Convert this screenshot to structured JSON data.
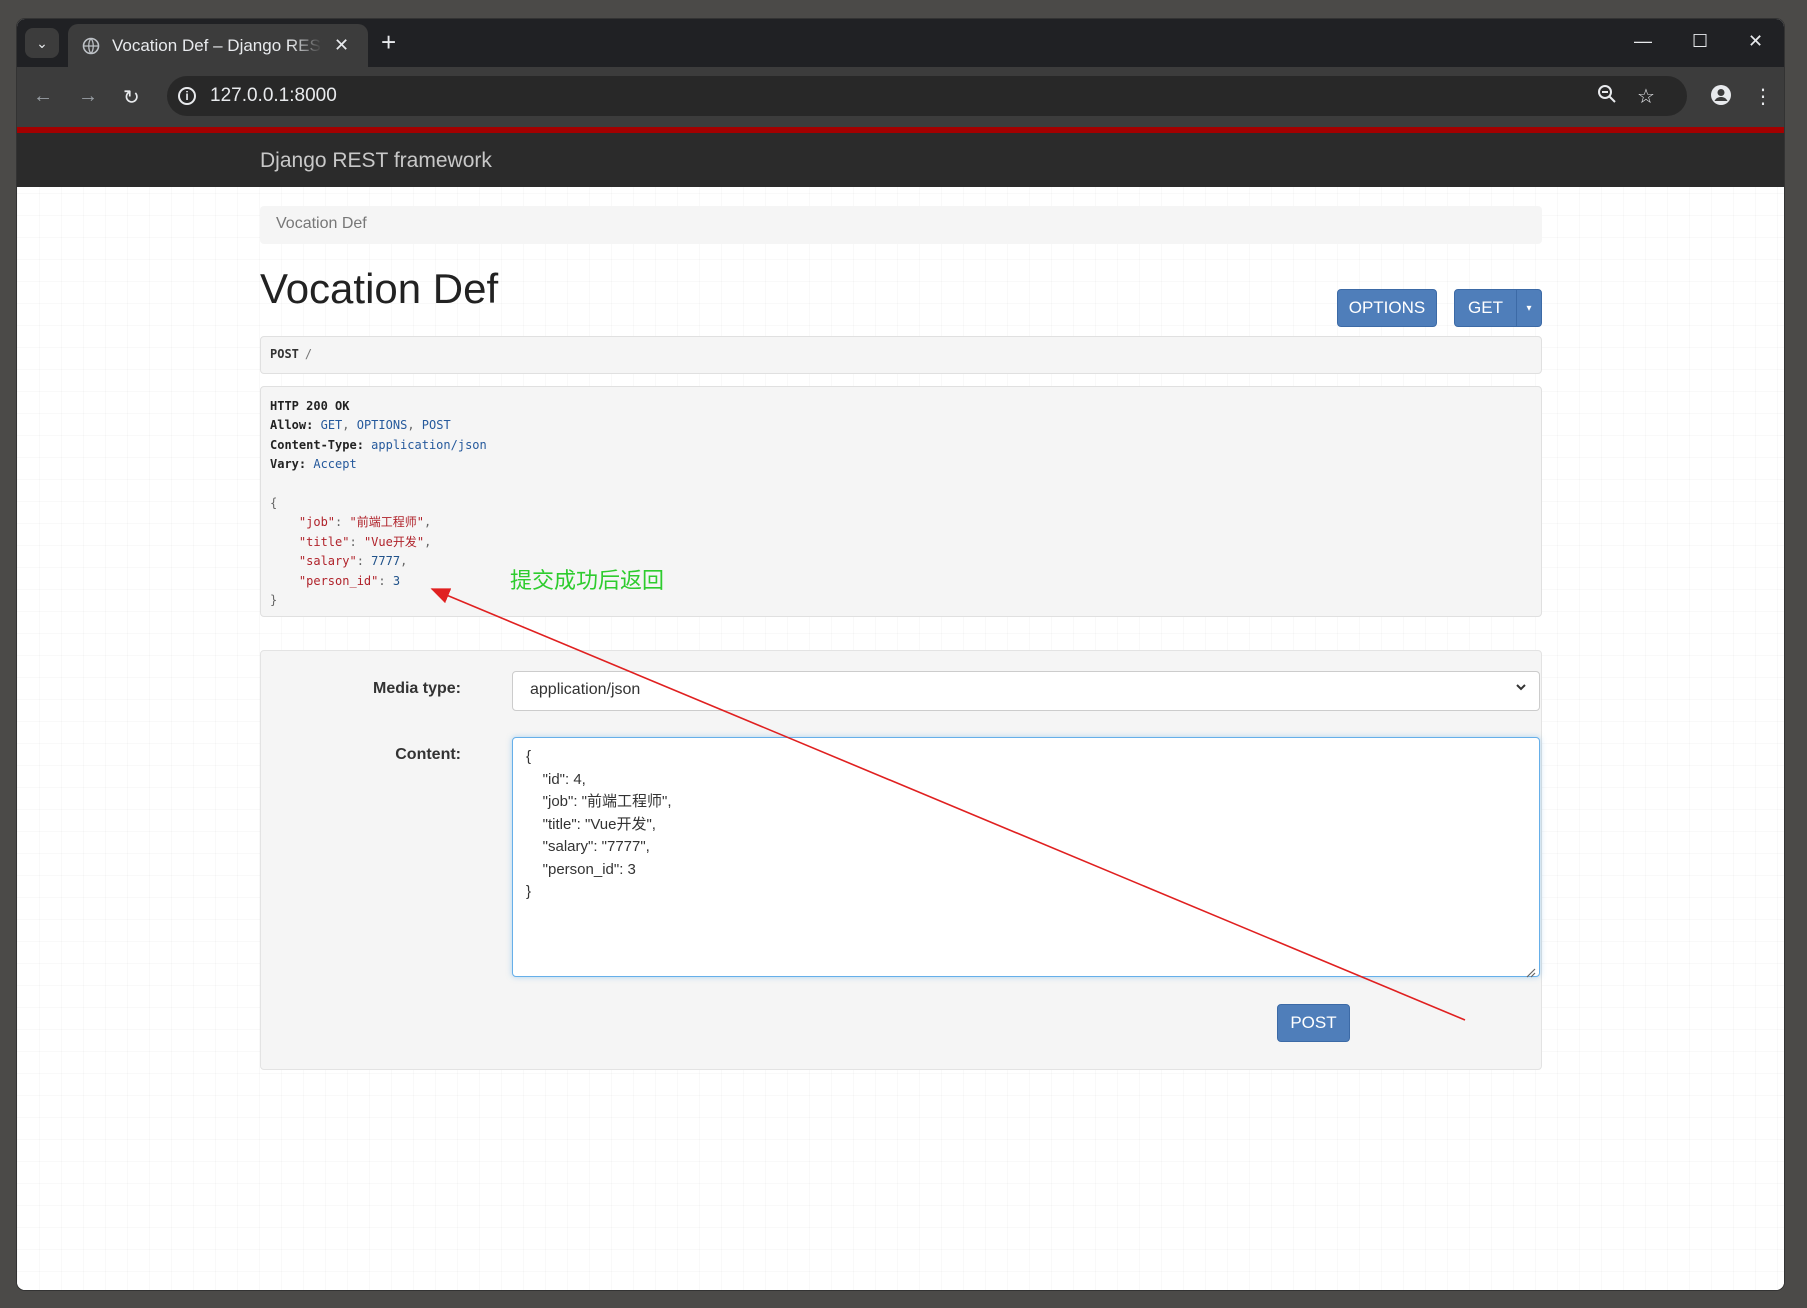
{
  "browser": {
    "tab_title": "Vocation Def – Django REST framework",
    "tab_close": "✕",
    "new_tab": "+",
    "url": "127.0.0.1:8000",
    "window_controls": {
      "minimize": "—",
      "maximize": "☐",
      "close": "✕"
    }
  },
  "navbar": {
    "brand": "Django REST framework"
  },
  "breadcrumb": {
    "item": "Vocation Def"
  },
  "page": {
    "title": "Vocation Def"
  },
  "toolbar": {
    "options_label": "OPTIONS",
    "get_label": "GET",
    "get_caret": "▾"
  },
  "request": {
    "method": "POST",
    "path": "/"
  },
  "response": {
    "status": "HTTP 200 OK",
    "allow_key": "Allow:",
    "allow_values": [
      "GET",
      "OPTIONS",
      "POST"
    ],
    "content_type_key": "Content-Type:",
    "content_type_value": "application/json",
    "vary_key": "Vary:",
    "vary_value": "Accept",
    "body": [
      {
        "key": "\"job\"",
        "value": "\"前端工程师\"",
        "kind": "str"
      },
      {
        "key": "\"title\"",
        "value": "\"Vue开发\"",
        "kind": "str"
      },
      {
        "key": "\"salary\"",
        "value": "7777",
        "kind": "num"
      },
      {
        "key": "\"person_id\"",
        "value": "3",
        "kind": "num"
      }
    ]
  },
  "annotation": {
    "text": "提交成功后返回",
    "color": "#2ecc2e",
    "arrow_color": "#e02020"
  },
  "form": {
    "media_type_label": "Media type:",
    "media_type_value": "application/json",
    "content_label": "Content:",
    "content_value": "{\n    \"id\": 4,\n    \"job\": \"前端工程师\",\n    \"title\": \"Vue开发\",\n    \"salary\": \"7777\",\n    \"person_id\": 3\n}",
    "post_label": "POST"
  },
  "colors": {
    "primary_button": "#4f7eba",
    "navbar": "#2b2b2b",
    "navbar_accent": "#a30000"
  }
}
